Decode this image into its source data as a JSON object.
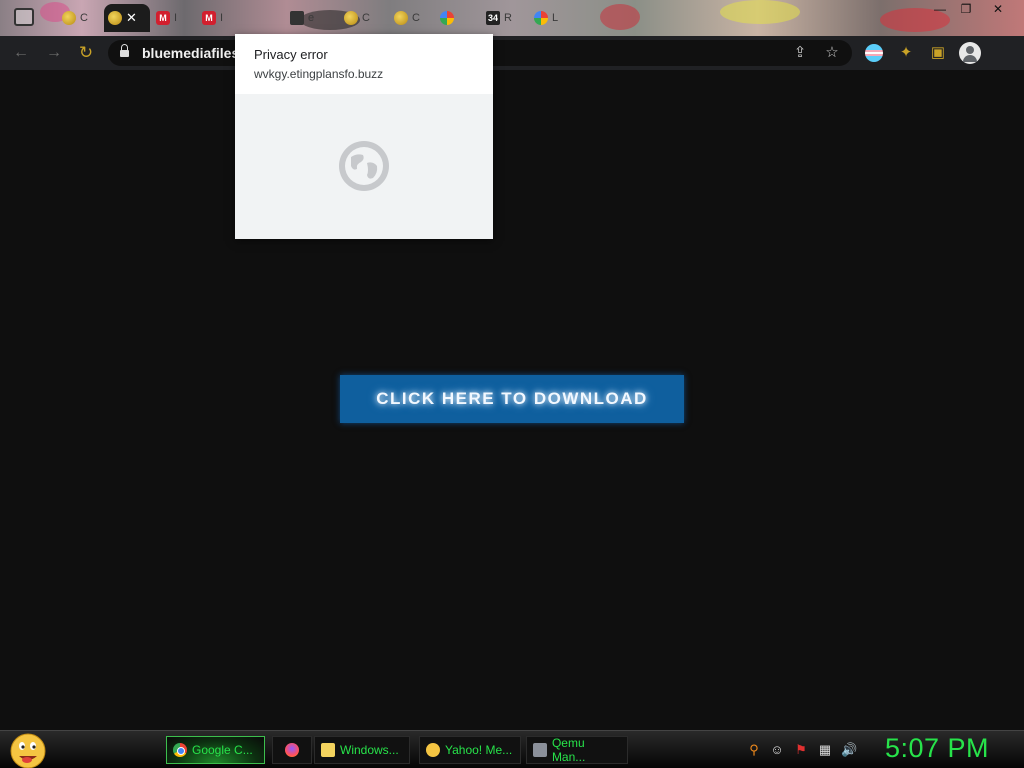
{
  "browser": {
    "tabs": [
      {
        "icon": "yellow-face-icon",
        "text": "C"
      },
      {
        "icon": "yellow-face-icon",
        "text": "",
        "active": true,
        "close": "✕"
      },
      {
        "icon": "gmail-icon",
        "text": "I"
      },
      {
        "icon": "gmail-icon",
        "text": "I"
      },
      {
        "icon": "pin-icon",
        "text": "e"
      },
      {
        "icon": "yellow-face-icon",
        "text": "C"
      },
      {
        "icon": "yellow-face-icon",
        "text": "C"
      },
      {
        "icon": "google-icon",
        "text": ""
      },
      {
        "icon": "badge-34-icon",
        "text": "R",
        "badge": "34"
      },
      {
        "icon": "google-icon",
        "text": "L"
      }
    ],
    "url_display": "bluemediafiles.",
    "window_controls": {
      "minimize": "—",
      "restore": "❐",
      "close": "✕"
    }
  },
  "popup": {
    "title": "Privacy error",
    "url": "wvkgy.etingplansfo.buzz"
  },
  "page": {
    "download_button": "CLICK HERE TO DOWNLOAD"
  },
  "taskbar": {
    "tasks": [
      {
        "icon": "chrome-icon",
        "label": "Google C..."
      },
      {
        "icon": "firefox-icon",
        "label": ""
      },
      {
        "icon": "folder-icon",
        "label": "Windows..."
      },
      {
        "icon": "yahoo-messenger-icon",
        "label": "Yahoo! Me..."
      },
      {
        "icon": "qemu-icon",
        "label": "Qemu Man..."
      }
    ],
    "clock": "5:07 PM"
  }
}
